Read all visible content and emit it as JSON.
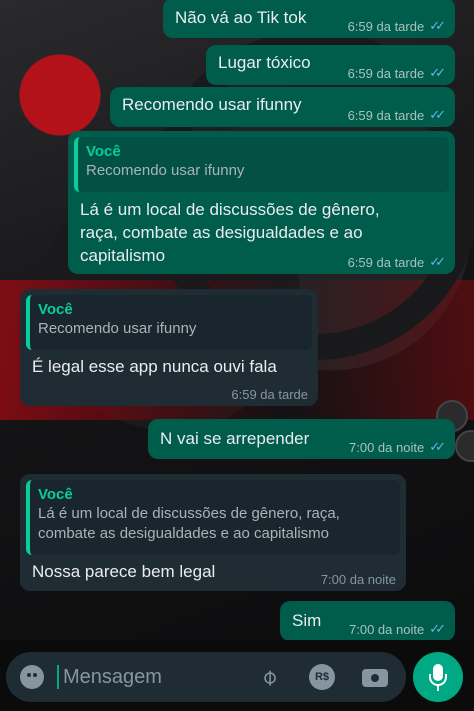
{
  "messages": [
    {
      "text": "Não vá ao Tik tok",
      "time": "6:59 da tarde"
    },
    {
      "text": "Lugar tóxico",
      "time": "6:59 da tarde"
    },
    {
      "text": "Recomendo usar ifunny",
      "time": "6:59 da tarde"
    },
    {
      "quote_author": "Você",
      "quote_text": "Recomendo usar ifunny",
      "lines": [
        "Lá é um local de discussões de gênero,",
        "raça, combate as desigualdades e ao",
        "capitalismo"
      ],
      "time": "6:59 da tarde"
    },
    {
      "quote_author": "Você",
      "quote_text": "Recomendo usar ifunny",
      "text": "É legal esse app nunca ouvi fala",
      "time": "6:59 da tarde"
    },
    {
      "text": "N vai se arrepender",
      "time": "7:00 da noite"
    },
    {
      "quote_author": "Você",
      "quote_lines": [
        "Lá é um local de discussões de gênero, raça,",
        "combate as desigualdades e ao capitalismo"
      ],
      "text": "Nossa parece bem legal",
      "time": "7:00 da noite"
    },
    {
      "text": "Sim",
      "time": "7:00 da noite"
    }
  ],
  "input": {
    "placeholder": "Mensagem",
    "pay_label": "R$"
  },
  "icons": {
    "read_receipt": "double-check-icon",
    "emoji": "emoji-icon",
    "attach": "paperclip-icon",
    "payment": "payment-icon",
    "camera": "camera-icon",
    "mic": "microphone-icon"
  },
  "colors": {
    "outgoing": "#005c4b",
    "incoming": "#1f2c34",
    "accent": "#00a884",
    "read_tick": "#53bdeb"
  }
}
